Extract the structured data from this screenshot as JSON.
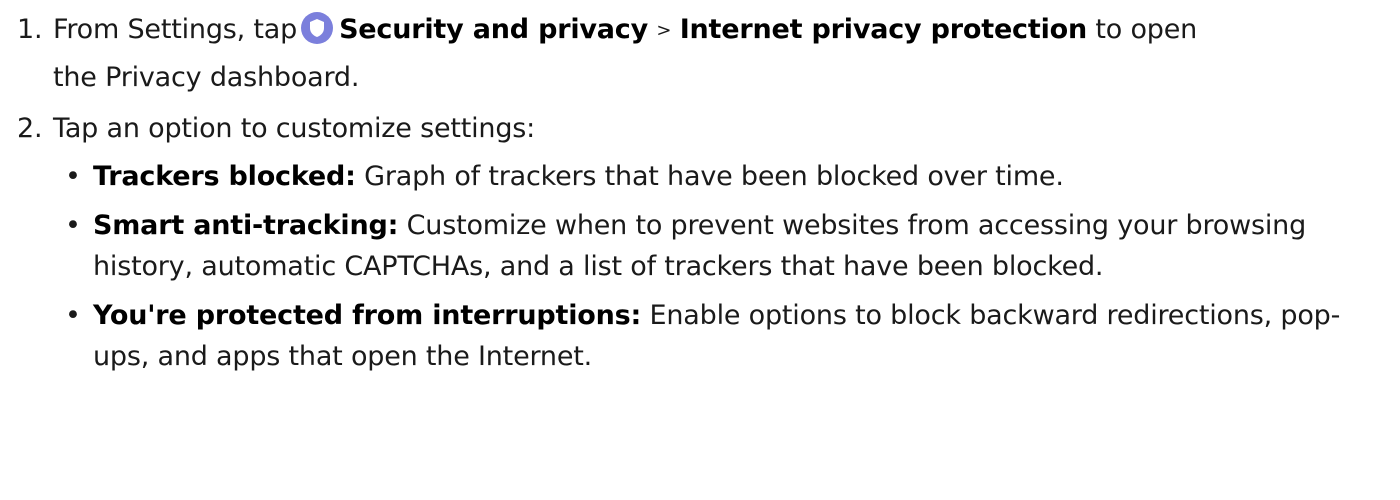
{
  "steps": [
    {
      "number": "1.",
      "prefix": "From Settings, tap",
      "icon": "shield-icon",
      "icon_color": "#7b7fdc",
      "link1": "Security and privacy",
      "separator": ">",
      "link2": "Internet privacy protection",
      "suffix_line1": "to open",
      "suffix_line2": "the Privacy dashboard."
    },
    {
      "number": "2.",
      "text": "Tap an option to customize settings:"
    }
  ],
  "bullets": [
    {
      "term": "Trackers blocked:",
      "description": "Graph of trackers that have been blocked over time."
    },
    {
      "term": "Smart anti-tracking:",
      "description": "Customize when to prevent websites from accessing your browsing history, automatic CAPTCHAs, and a list of trackers that have been blocked."
    },
    {
      "term": "You're protected from interruptions:",
      "description": "Enable options to block backward redirections, pop-ups, and apps that open the Internet."
    }
  ]
}
